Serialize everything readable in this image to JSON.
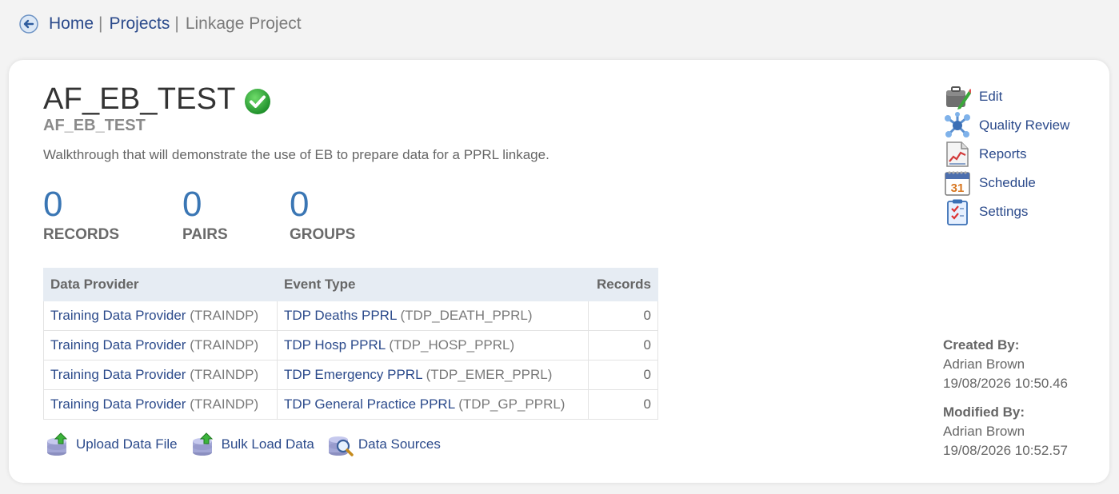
{
  "breadcrumb": {
    "home": "Home",
    "projects": "Projects",
    "separator": "|",
    "current": "Linkage Project"
  },
  "project": {
    "title": "AF_EB_TEST",
    "subtitle": "AF_EB_TEST",
    "description": "Walkthrough that will demonstrate the use of EB to prepare data for a PPRL linkage.",
    "status_icon": "check-circle-icon"
  },
  "stats": [
    {
      "value": "0",
      "label": "RECORDS"
    },
    {
      "value": "0",
      "label": "PAIRS"
    },
    {
      "value": "0",
      "label": "GROUPS"
    }
  ],
  "table": {
    "headers": [
      "Data Provider",
      "Event Type",
      "Records"
    ],
    "rows": [
      {
        "provider": "Training Data Provider",
        "provider_code": "(TRAINDP)",
        "event": "TDP Deaths PPRL",
        "event_code": "(TDP_DEATH_PPRL)",
        "records": "0"
      },
      {
        "provider": "Training Data Provider",
        "provider_code": "(TRAINDP)",
        "event": "TDP Hosp PPRL",
        "event_code": "(TDP_HOSP_PPRL)",
        "records": "0"
      },
      {
        "provider": "Training Data Provider",
        "provider_code": "(TRAINDP)",
        "event": "TDP Emergency PPRL",
        "event_code": "(TDP_EMER_PPRL)",
        "records": "0"
      },
      {
        "provider": "Training Data Provider",
        "provider_code": "(TRAINDP)",
        "event": "TDP General Practice PPRL",
        "event_code": "(TDP_GP_PPRL)",
        "records": "0"
      }
    ]
  },
  "actions": {
    "upload": "Upload Data File",
    "bulk": "Bulk Load Data",
    "sources": "Data Sources"
  },
  "menu": {
    "edit": "Edit",
    "quality": "Quality Review",
    "reports": "Reports",
    "schedule": "Schedule",
    "settings": "Settings",
    "calendar_day": "31"
  },
  "meta": {
    "created_label": "Created By:",
    "created_by": "Adrian Brown",
    "created_at": "19/08/2026 10:50.46",
    "modified_label": "Modified By:",
    "modified_by": "Adrian Brown",
    "modified_at": "19/08/2026 10:52.57"
  },
  "colors": {
    "link": "#2b4a8b",
    "stat_value": "#3a76b4",
    "table_header_bg": "#e6ecf3",
    "success": "#2aa334"
  }
}
